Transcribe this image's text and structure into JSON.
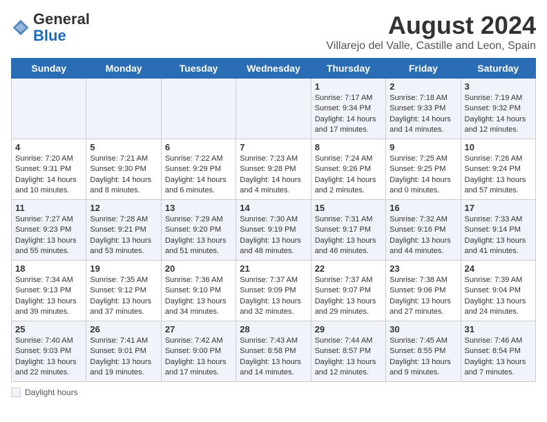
{
  "header": {
    "logo_line1": "General",
    "logo_line2": "Blue",
    "main_title": "August 2024",
    "subtitle": "Villarejo del Valle, Castille and Leon, Spain"
  },
  "columns": [
    "Sunday",
    "Monday",
    "Tuesday",
    "Wednesday",
    "Thursday",
    "Friday",
    "Saturday"
  ],
  "weeks": [
    [
      {
        "day": "",
        "info": ""
      },
      {
        "day": "",
        "info": ""
      },
      {
        "day": "",
        "info": ""
      },
      {
        "day": "",
        "info": ""
      },
      {
        "day": "1",
        "info": "Sunrise: 7:17 AM\nSunset: 9:34 PM\nDaylight: 14 hours and 17 minutes."
      },
      {
        "day": "2",
        "info": "Sunrise: 7:18 AM\nSunset: 9:33 PM\nDaylight: 14 hours and 14 minutes."
      },
      {
        "day": "3",
        "info": "Sunrise: 7:19 AM\nSunset: 9:32 PM\nDaylight: 14 hours and 12 minutes."
      }
    ],
    [
      {
        "day": "4",
        "info": "Sunrise: 7:20 AM\nSunset: 9:31 PM\nDaylight: 14 hours and 10 minutes."
      },
      {
        "day": "5",
        "info": "Sunrise: 7:21 AM\nSunset: 9:30 PM\nDaylight: 14 hours and 8 minutes."
      },
      {
        "day": "6",
        "info": "Sunrise: 7:22 AM\nSunset: 9:29 PM\nDaylight: 14 hours and 6 minutes."
      },
      {
        "day": "7",
        "info": "Sunrise: 7:23 AM\nSunset: 9:28 PM\nDaylight: 14 hours and 4 minutes."
      },
      {
        "day": "8",
        "info": "Sunrise: 7:24 AM\nSunset: 9:26 PM\nDaylight: 14 hours and 2 minutes."
      },
      {
        "day": "9",
        "info": "Sunrise: 7:25 AM\nSunset: 9:25 PM\nDaylight: 14 hours and 0 minutes."
      },
      {
        "day": "10",
        "info": "Sunrise: 7:26 AM\nSunset: 9:24 PM\nDaylight: 13 hours and 57 minutes."
      }
    ],
    [
      {
        "day": "11",
        "info": "Sunrise: 7:27 AM\nSunset: 9:23 PM\nDaylight: 13 hours and 55 minutes."
      },
      {
        "day": "12",
        "info": "Sunrise: 7:28 AM\nSunset: 9:21 PM\nDaylight: 13 hours and 53 minutes."
      },
      {
        "day": "13",
        "info": "Sunrise: 7:29 AM\nSunset: 9:20 PM\nDaylight: 13 hours and 51 minutes."
      },
      {
        "day": "14",
        "info": "Sunrise: 7:30 AM\nSunset: 9:19 PM\nDaylight: 13 hours and 48 minutes."
      },
      {
        "day": "15",
        "info": "Sunrise: 7:31 AM\nSunset: 9:17 PM\nDaylight: 13 hours and 46 minutes."
      },
      {
        "day": "16",
        "info": "Sunrise: 7:32 AM\nSunset: 9:16 PM\nDaylight: 13 hours and 44 minutes."
      },
      {
        "day": "17",
        "info": "Sunrise: 7:33 AM\nSunset: 9:14 PM\nDaylight: 13 hours and 41 minutes."
      }
    ],
    [
      {
        "day": "18",
        "info": "Sunrise: 7:34 AM\nSunset: 9:13 PM\nDaylight: 13 hours and 39 minutes."
      },
      {
        "day": "19",
        "info": "Sunrise: 7:35 AM\nSunset: 9:12 PM\nDaylight: 13 hours and 37 minutes."
      },
      {
        "day": "20",
        "info": "Sunrise: 7:36 AM\nSunset: 9:10 PM\nDaylight: 13 hours and 34 minutes."
      },
      {
        "day": "21",
        "info": "Sunrise: 7:37 AM\nSunset: 9:09 PM\nDaylight: 13 hours and 32 minutes."
      },
      {
        "day": "22",
        "info": "Sunrise: 7:37 AM\nSunset: 9:07 PM\nDaylight: 13 hours and 29 minutes."
      },
      {
        "day": "23",
        "info": "Sunrise: 7:38 AM\nSunset: 9:06 PM\nDaylight: 13 hours and 27 minutes."
      },
      {
        "day": "24",
        "info": "Sunrise: 7:39 AM\nSunset: 9:04 PM\nDaylight: 13 hours and 24 minutes."
      }
    ],
    [
      {
        "day": "25",
        "info": "Sunrise: 7:40 AM\nSunset: 9:03 PM\nDaylight: 13 hours and 22 minutes."
      },
      {
        "day": "26",
        "info": "Sunrise: 7:41 AM\nSunset: 9:01 PM\nDaylight: 13 hours and 19 minutes."
      },
      {
        "day": "27",
        "info": "Sunrise: 7:42 AM\nSunset: 9:00 PM\nDaylight: 13 hours and 17 minutes."
      },
      {
        "day": "28",
        "info": "Sunrise: 7:43 AM\nSunset: 8:58 PM\nDaylight: 13 hours and 14 minutes."
      },
      {
        "day": "29",
        "info": "Sunrise: 7:44 AM\nSunset: 8:57 PM\nDaylight: 13 hours and 12 minutes."
      },
      {
        "day": "30",
        "info": "Sunrise: 7:45 AM\nSunset: 8:55 PM\nDaylight: 13 hours and 9 minutes."
      },
      {
        "day": "31",
        "info": "Sunrise: 7:46 AM\nSunset: 8:54 PM\nDaylight: 13 hours and 7 minutes."
      }
    ]
  ],
  "footer": {
    "daylight_label": "Daylight hours"
  }
}
